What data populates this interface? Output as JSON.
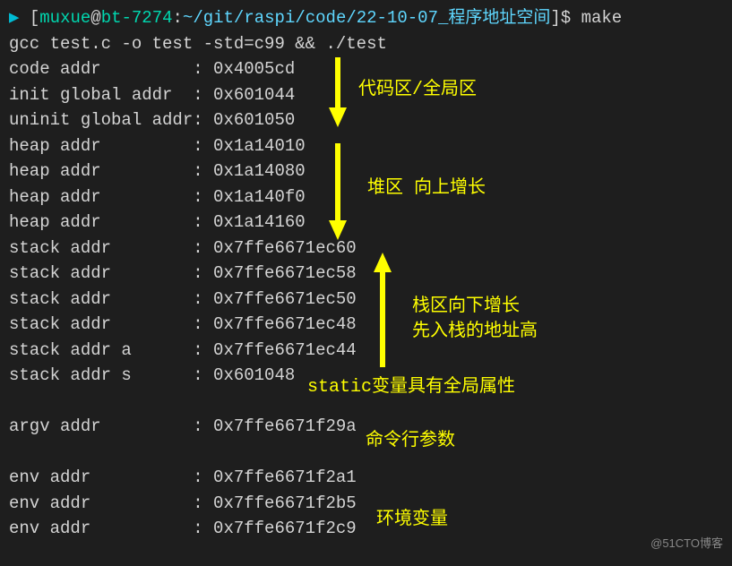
{
  "prompt": {
    "arrow": "▶",
    "open": "[",
    "user": "muxue",
    "at": "@",
    "host": "bt-7274",
    "colon": ":",
    "path_en": "~/git/raspi/code/22-10-07_",
    "path_cn": "程序地址空间",
    "close": "]$",
    "cmd": " make"
  },
  "compile_line": "gcc test.c -o test -std=c99 && ./test",
  "rows": [
    {
      "label": "code addr         ",
      "sep": ": ",
      "value": "0x4005cd"
    },
    {
      "label": "init global addr  ",
      "sep": ": ",
      "value": "0x601044"
    },
    {
      "label": "uninit global addr",
      "sep": ": ",
      "value": "0x601050"
    },
    {
      "label": "heap addr         ",
      "sep": ": ",
      "value": "0x1a14010"
    },
    {
      "label": "heap addr         ",
      "sep": ": ",
      "value": "0x1a14080"
    },
    {
      "label": "heap addr         ",
      "sep": ": ",
      "value": "0x1a140f0"
    },
    {
      "label": "heap addr         ",
      "sep": ": ",
      "value": "0x1a14160"
    },
    {
      "label": "stack addr        ",
      "sep": ": ",
      "value": "0x7ffe6671ec60"
    },
    {
      "label": "stack addr        ",
      "sep": ": ",
      "value": "0x7ffe6671ec58"
    },
    {
      "label": "stack addr        ",
      "sep": ": ",
      "value": "0x7ffe6671ec50"
    },
    {
      "label": "stack addr        ",
      "sep": ": ",
      "value": "0x7ffe6671ec48"
    },
    {
      "label": "stack addr a      ",
      "sep": ": ",
      "value": "0x7ffe6671ec44"
    },
    {
      "label": "stack addr s      ",
      "sep": ": ",
      "value": "0x601048"
    },
    {
      "label": "",
      "sep": "",
      "value": ""
    },
    {
      "label": "argv addr         ",
      "sep": ": ",
      "value": "0x7ffe6671f29a"
    },
    {
      "label": "",
      "sep": "",
      "value": ""
    },
    {
      "label": "env addr          ",
      "sep": ": ",
      "value": "0x7ffe6671f2a1"
    },
    {
      "label": "env addr          ",
      "sep": ": ",
      "value": "0x7ffe6671f2b5"
    },
    {
      "label": "env addr          ",
      "sep": ": ",
      "value": "0x7ffe6671f2c9"
    }
  ],
  "annotations": {
    "code_global": "代码区/全局区",
    "heap": "堆区 向上增长",
    "stack1": "栈区向下增长",
    "stack2": "先入栈的地址高",
    "static_var": "static变量具有全局属性",
    "argv": "命令行参数",
    "env": "环境变量"
  },
  "watermark": "@51CTO博客"
}
